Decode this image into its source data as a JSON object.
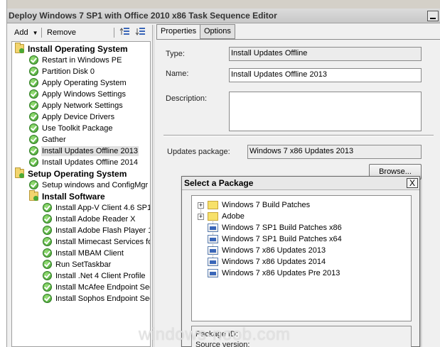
{
  "window": {
    "title": "Deploy Windows 7 SP1 with Office 2010 x86 Task Sequence Editor"
  },
  "toolbar": {
    "add_label": "Add",
    "remove_label": "Remove"
  },
  "tree": [
    {
      "label": "Install Operating System",
      "kind": "group"
    },
    {
      "label": "Restart in Windows PE",
      "kind": "step"
    },
    {
      "label": "Partition Disk 0",
      "kind": "step"
    },
    {
      "label": "Apply Operating System",
      "kind": "step"
    },
    {
      "label": "Apply Windows Settings",
      "kind": "step"
    },
    {
      "label": "Apply Network Settings",
      "kind": "step"
    },
    {
      "label": "Apply Device Drivers",
      "kind": "step"
    },
    {
      "label": "Use Toolkit Package",
      "kind": "step"
    },
    {
      "label": "Gather",
      "kind": "step"
    },
    {
      "label": "Install Updates Offline 2013",
      "kind": "step",
      "selected": true
    },
    {
      "label": "Install Updates Offline 2014",
      "kind": "step"
    },
    {
      "label": "Setup Operating System",
      "kind": "group"
    },
    {
      "label": "Setup windows and ConfigMgr",
      "kind": "step"
    },
    {
      "label": "Install Software",
      "kind": "group"
    },
    {
      "label": "Install App-V Client 4.6 SP1",
      "kind": "step"
    },
    {
      "label": "Install Adobe Reader X",
      "kind": "step"
    },
    {
      "label": "Install Adobe Flash Player 1",
      "kind": "step"
    },
    {
      "label": "Install Mimecast Services fo",
      "kind": "step"
    },
    {
      "label": "Install MBAM Client",
      "kind": "step"
    },
    {
      "label": "Run SetTaskbar",
      "kind": "step"
    },
    {
      "label": "Install .Net 4 Client Profile",
      "kind": "step"
    },
    {
      "label": "Install McAfee Endpoint Sec",
      "kind": "step"
    },
    {
      "label": "Install Sophos Endpoint Sec",
      "kind": "step"
    }
  ],
  "tabs": {
    "properties": "Properties",
    "options": "Options"
  },
  "properties": {
    "type_label": "Type:",
    "type_value": "Install Updates Offline",
    "name_label": "Name:",
    "name_value": "Install Updates Offline 2013",
    "description_label": "Description:",
    "description_value": "",
    "updates_package_label": "Updates package:",
    "updates_package_value": "Windows 7 x86 Updates 2013",
    "browse_label": "Browse..."
  },
  "dialog": {
    "title": "Select a Package",
    "close_label": "X",
    "items": [
      {
        "label": "Windows 7 Build Patches",
        "kind": "folder"
      },
      {
        "label": "Adobe",
        "kind": "folder"
      },
      {
        "label": "Windows 7 SP1 Build Patches x86",
        "kind": "package"
      },
      {
        "label": "Windows 7 SP1 Build Patches x64",
        "kind": "package"
      },
      {
        "label": "Windows 7 x86 Updates 2013",
        "kind": "package"
      },
      {
        "label": "Windows 7 x86 Updates 2014",
        "kind": "package"
      },
      {
        "label": "Windows 7 x86 Updates Pre 2013",
        "kind": "package"
      }
    ],
    "expander": "+",
    "package_id_label": "Package ID:",
    "source_version_label": "Source version:"
  },
  "watermark": "windows-noob.com",
  "colors": {
    "selected_row": "#e0e0e0",
    "check_green": "#3d9a2c",
    "folder_yellow": "#f2d46e"
  }
}
